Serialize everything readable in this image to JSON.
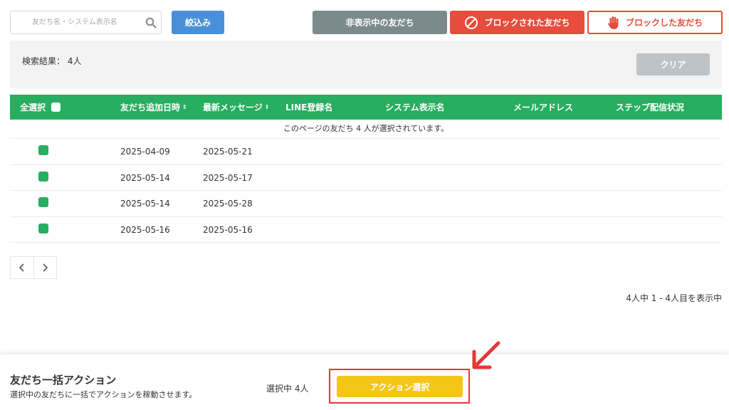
{
  "toolbar": {
    "search_placeholder": "友だち名・システム表示名",
    "filter_label": "絞込み",
    "hidden_friends_label": "非表示中の友だち",
    "blocked_by_label": "ブロックされた友だち",
    "blocking_label": "ブロックした友だち"
  },
  "result": {
    "label": "検索結果： 4人",
    "clear_label": "クリア"
  },
  "table": {
    "headers": {
      "select_all": "全選択",
      "added_at": "友だち追加日時",
      "latest_message": "最新メッセージ",
      "line_name": "LINE登録名",
      "system_name": "システム表示名",
      "email": "メールアドレス",
      "step_status": "ステップ配信状況"
    },
    "sort_icon": "⇕",
    "selection_notice": "このページの友だち 4 人が選択されています。",
    "rows": [
      {
        "added_at": "2025-04-09",
        "latest_message": "2025-05-21",
        "line_name": "",
        "system_name": "",
        "email": "",
        "step_status": ""
      },
      {
        "added_at": "2025-05-14",
        "latest_message": "2025-05-17",
        "line_name": "",
        "system_name": "",
        "email": "",
        "step_status": ""
      },
      {
        "added_at": "2025-05-14",
        "latest_message": "2025-05-28",
        "line_name": "",
        "system_name": "",
        "email": "",
        "step_status": ""
      },
      {
        "added_at": "2025-05-16",
        "latest_message": "2025-05-16",
        "line_name": "",
        "system_name": "",
        "email": "",
        "step_status": ""
      }
    ]
  },
  "pagination": {
    "prev_icon": "chevron-left-icon",
    "next_icon": "chevron-right-icon",
    "showing_text": "4人中 1 - 4人目を表示中"
  },
  "bulk_action": {
    "title": "友だち一括アクション",
    "description": "選択中の友だちに一括でアクションを稼動させます。",
    "selected_count": "選択中 4人",
    "action_button_label": "アクション選択"
  },
  "colors": {
    "accent_green": "#27ae60",
    "filter_blue": "#4a90d9",
    "hidden_gray": "#7b8a8b",
    "danger_red": "#e74c3c",
    "action_yellow": "#f5c518",
    "annotation_red": "#e53935"
  }
}
